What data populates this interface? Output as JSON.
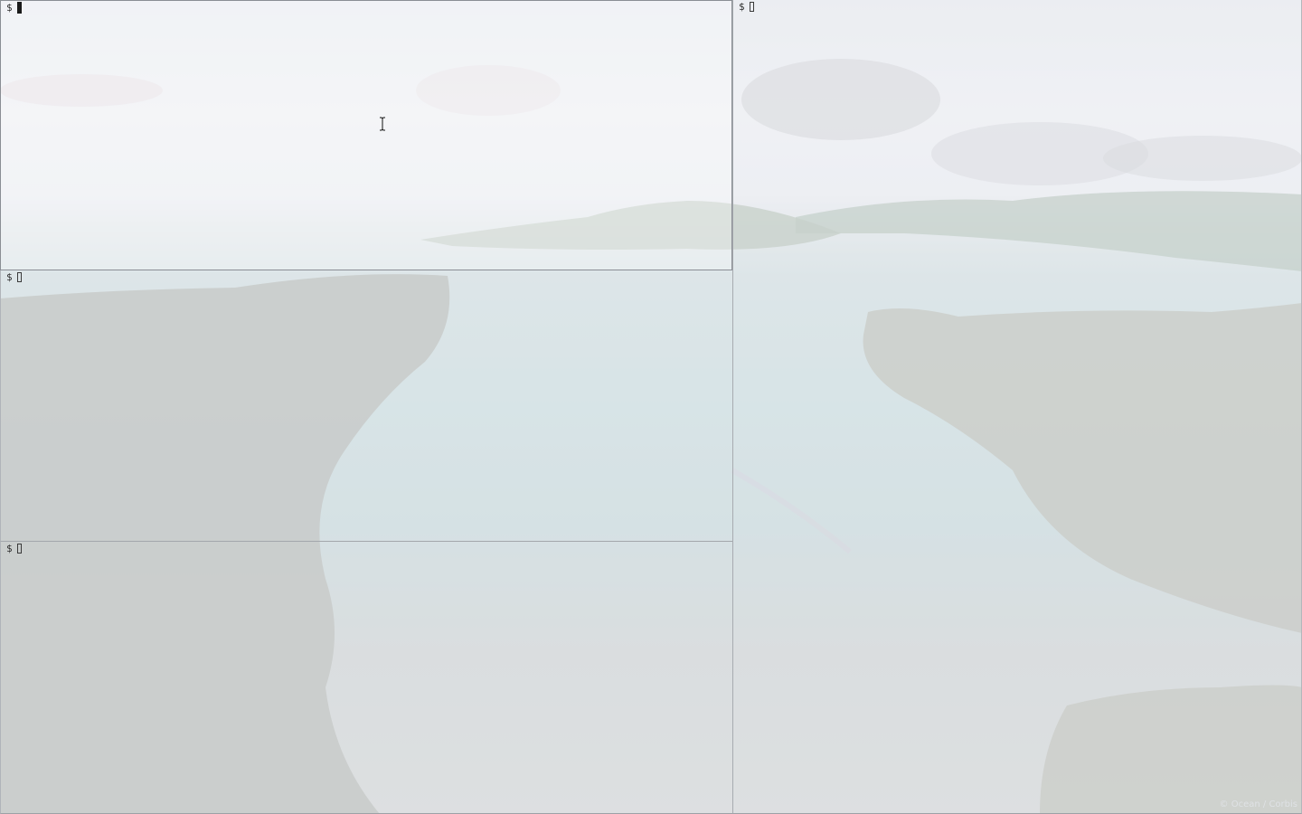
{
  "terminals": [
    {
      "id": "top-left",
      "prompt": "$",
      "focused": true
    },
    {
      "id": "mid-left",
      "prompt": "$",
      "focused": false
    },
    {
      "id": "bottom-left",
      "prompt": "$",
      "focused": false
    },
    {
      "id": "right",
      "prompt": "$",
      "focused": false
    }
  ],
  "wallpaper": {
    "credit": "© Ocean / Corbis"
  },
  "colors": {
    "pane_border": "#8a8e94",
    "text": "#2b2b2b"
  }
}
